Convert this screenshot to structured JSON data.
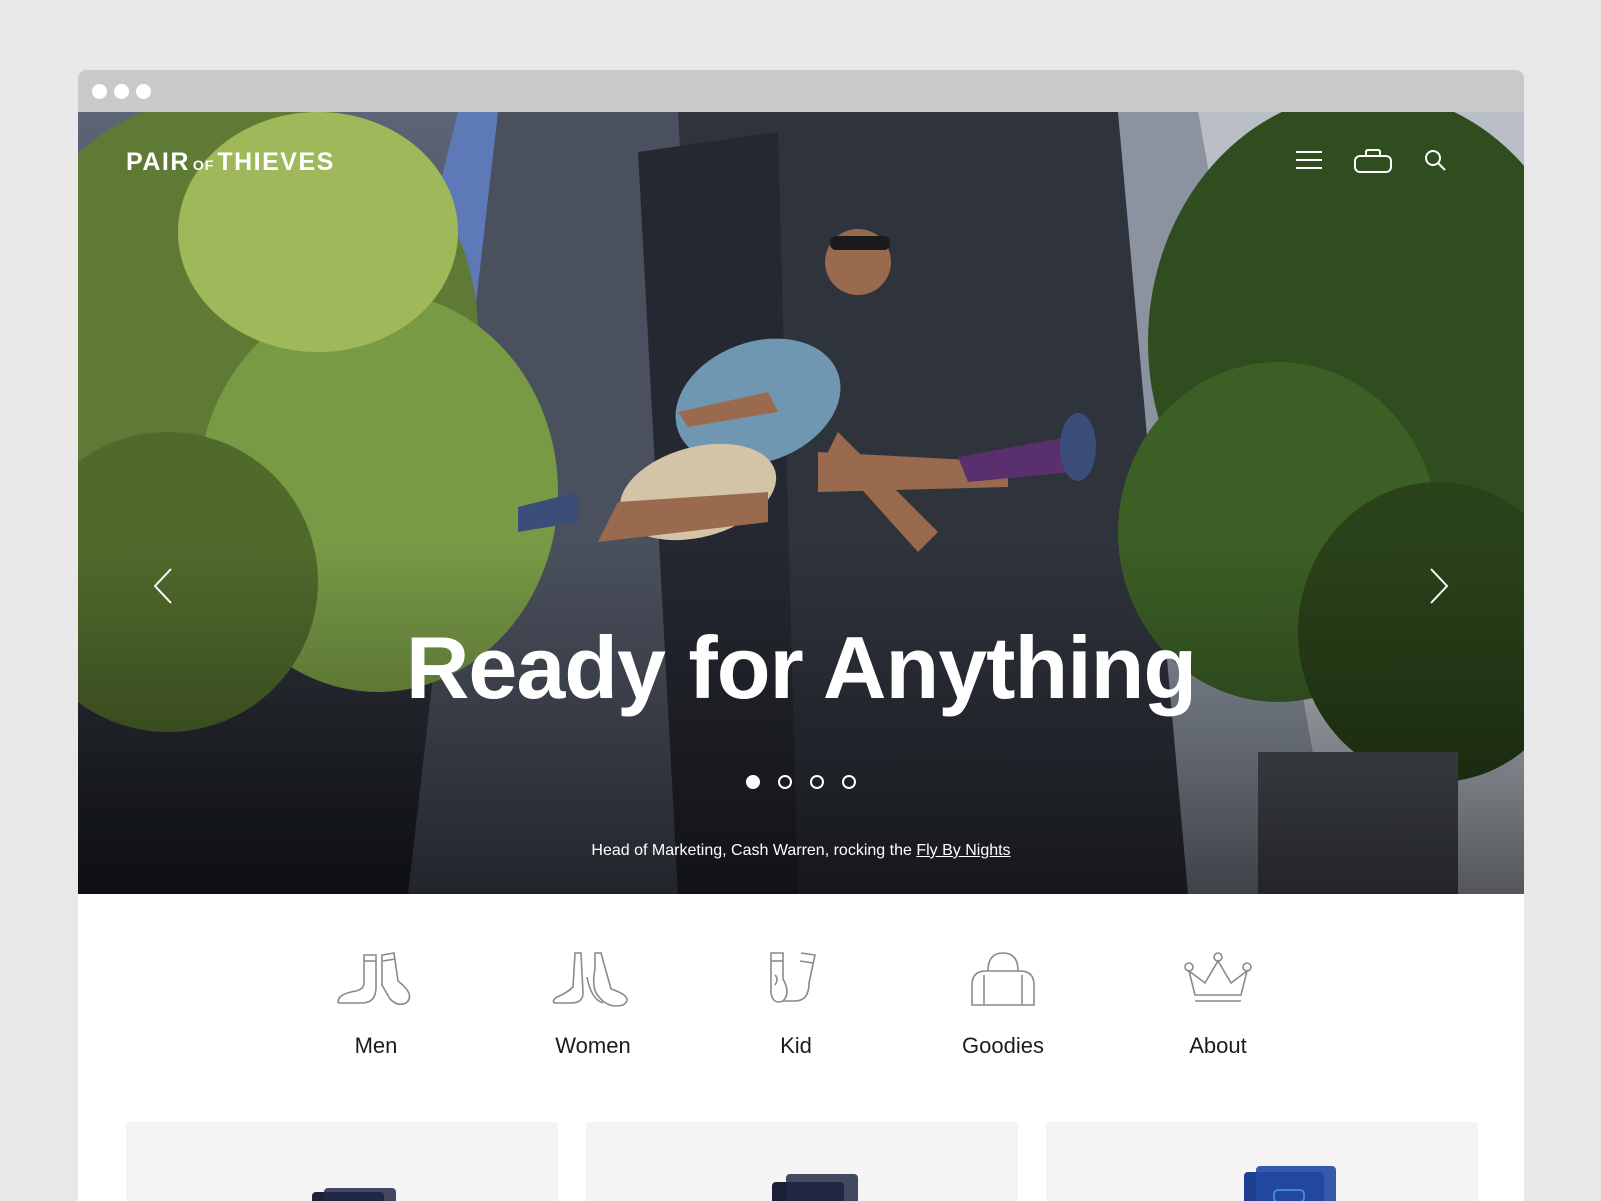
{
  "browser": {
    "window_controls": [
      "close",
      "minimize",
      "maximize"
    ]
  },
  "header": {
    "logo": {
      "part1": "PAIR",
      "part2": "OF",
      "part3": "THIEVES"
    },
    "icons": [
      "menu-icon",
      "bag-icon",
      "search-icon"
    ]
  },
  "hero": {
    "headline": "Ready for Anything",
    "caption_prefix": "Head of Marketing, Cash Warren, rocking the ",
    "caption_link": "Fly By Nights",
    "slides": 4,
    "active_slide": 1
  },
  "categories": [
    {
      "label": "Men",
      "icon": "men-socks-icon"
    },
    {
      "label": "Women",
      "icon": "women-socks-icon"
    },
    {
      "label": "Kid",
      "icon": "kid-socks-icon"
    },
    {
      "label": "Goodies",
      "icon": "duffel-bag-icon"
    },
    {
      "label": "About",
      "icon": "crown-icon"
    }
  ],
  "products": [
    {
      "color": "#1c2238"
    },
    {
      "color": "#1a2036"
    },
    {
      "color": "#1e3f8f"
    }
  ],
  "colors": {
    "page_bg": "#e8e8e8",
    "titlebar": "#c9c9c9",
    "icon_stroke": "#8a8a8a",
    "card_bg": "#f4f4f4"
  }
}
